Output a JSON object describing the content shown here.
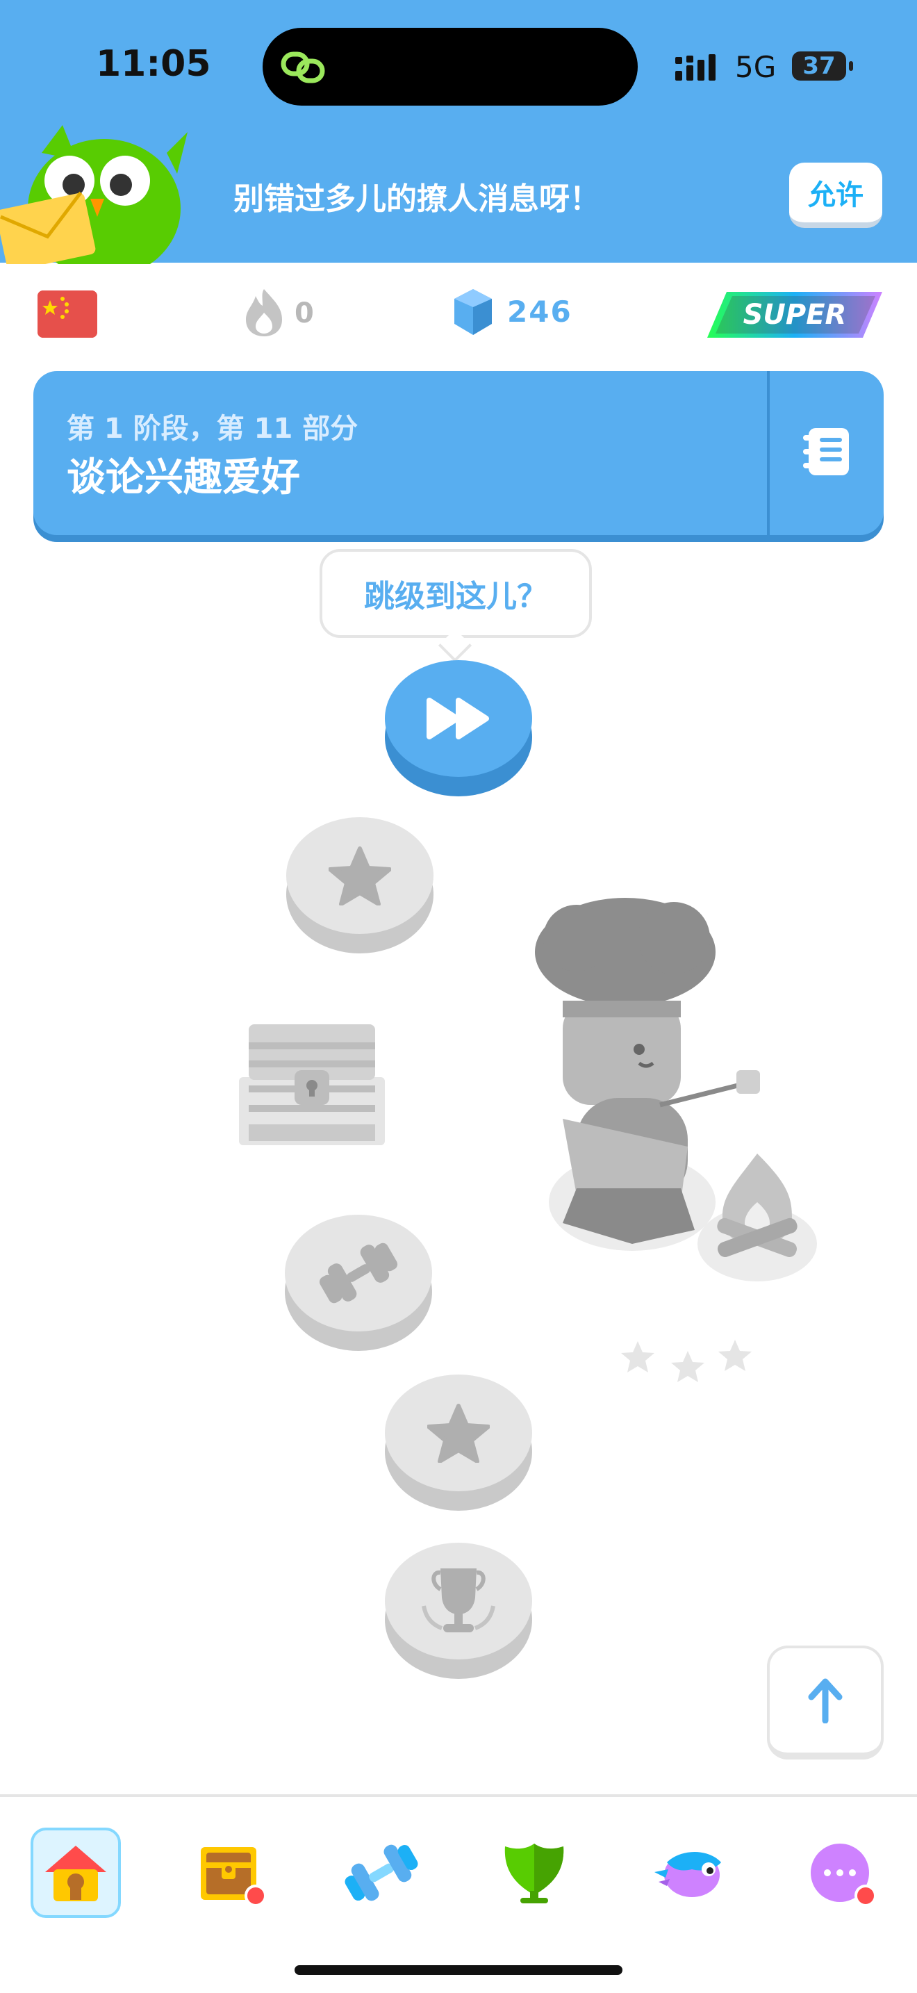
{
  "status_bar": {
    "time": "11:05",
    "network": "5G",
    "battery": "37"
  },
  "banner": {
    "message": "别错过多儿的撩人消息呀！",
    "allow_label": "允许"
  },
  "stats": {
    "streak": "0",
    "gems": "246",
    "super_label": "SUPER",
    "flag": "china-flag"
  },
  "unit": {
    "subtitle": "第 1 阶段，第 11 部分",
    "title": "谈论兴趣爱好"
  },
  "path": {
    "tooltip": "跳级到这儿？",
    "nodes": [
      {
        "type": "jump",
        "icon": "fast-forward-icon",
        "state": "active"
      },
      {
        "type": "lesson",
        "icon": "star-icon",
        "state": "locked"
      },
      {
        "type": "chest",
        "icon": "treasure-chest-icon",
        "state": "locked"
      },
      {
        "type": "practice",
        "icon": "dumbbell-icon",
        "state": "locked"
      },
      {
        "type": "lesson",
        "icon": "star-icon",
        "state": "locked"
      },
      {
        "type": "trophy",
        "icon": "trophy-icon",
        "state": "locked"
      }
    ]
  },
  "bottom_nav": {
    "items": [
      {
        "name": "home",
        "icon": "home-icon",
        "active": true
      },
      {
        "name": "quests",
        "icon": "treasure-icon",
        "badge": true
      },
      {
        "name": "practice",
        "icon": "dumbbell-icon"
      },
      {
        "name": "leaderboard",
        "icon": "shield-icon"
      },
      {
        "name": "characters",
        "icon": "bird-icon"
      },
      {
        "name": "more",
        "icon": "more-icon",
        "badge": true
      }
    ]
  },
  "colors": {
    "primary_blue": "#58aef0",
    "dark_blue": "#3b8fd2",
    "locked_gray": "#e5e5e5",
    "badge_red": "#ff4b4b"
  }
}
